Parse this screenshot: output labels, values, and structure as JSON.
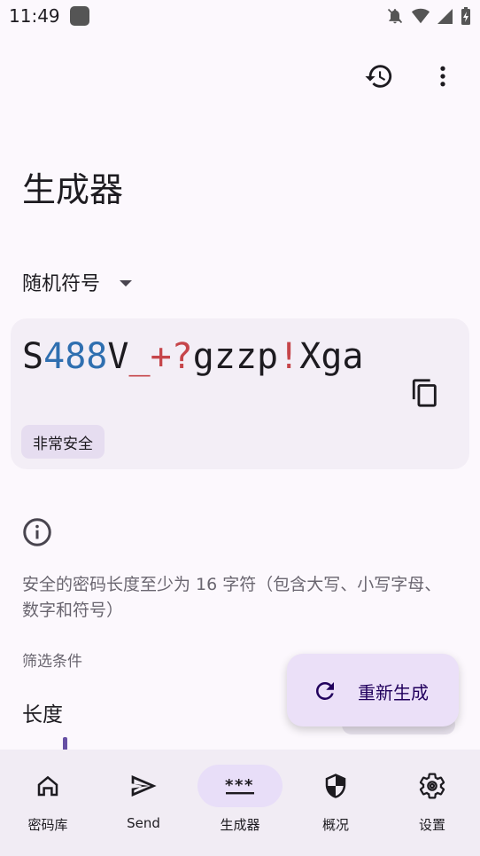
{
  "status_bar": {
    "time": "11:49"
  },
  "header": {
    "title": "生成器"
  },
  "generator": {
    "type_label": "随机符号",
    "password": [
      {
        "ch": "S",
        "kind": "letter"
      },
      {
        "ch": "4",
        "kind": "num"
      },
      {
        "ch": "8",
        "kind": "num"
      },
      {
        "ch": "8",
        "kind": "num"
      },
      {
        "ch": "V",
        "kind": "letter"
      },
      {
        "ch": "_",
        "kind": "sym"
      },
      {
        "ch": "+",
        "kind": "sym"
      },
      {
        "ch": "?",
        "kind": "sym"
      },
      {
        "ch": "g",
        "kind": "letter"
      },
      {
        "ch": "z",
        "kind": "letter"
      },
      {
        "ch": "z",
        "kind": "letter"
      },
      {
        "ch": "p",
        "kind": "letter"
      },
      {
        "ch": "!",
        "kind": "sym"
      },
      {
        "ch": "X",
        "kind": "letter"
      },
      {
        "ch": "g",
        "kind": "letter"
      },
      {
        "ch": "a",
        "kind": "letter"
      }
    ],
    "strength_label": "非常安全",
    "tip": "安全的密码长度至少为 16 字符（包含大写、小写字母、数字和符号）",
    "filter_heading": "筛选条件",
    "length_label": "长度"
  },
  "fab": {
    "label": "重新生成"
  },
  "bottom_nav": [
    {
      "label": "密码库",
      "icon": "home-icon",
      "active": false
    },
    {
      "label": "Send",
      "icon": "send-icon",
      "active": false
    },
    {
      "label": "生成器",
      "icon": "password-generator-icon",
      "active": true
    },
    {
      "label": "概况",
      "icon": "shield-icon",
      "active": false
    },
    {
      "label": "设置",
      "icon": "gear-icon",
      "active": false
    }
  ],
  "colors": {
    "accent": "#6750a4",
    "password_number": "#2f6fb0",
    "password_symbol": "#c6454a",
    "card_bg": "#f3eef6",
    "nav_active": "#e8def8"
  }
}
